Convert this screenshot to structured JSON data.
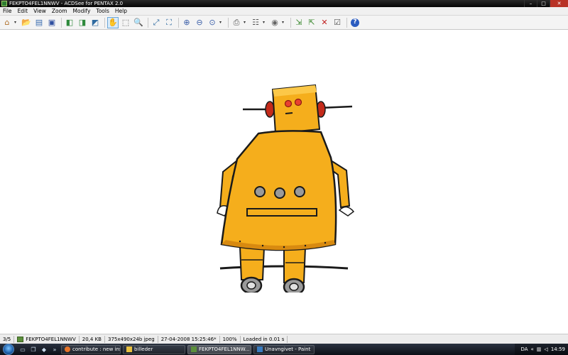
{
  "window": {
    "title": "FEKPTO4FEL1NNWV - ACDSee for PENTAX 2.0",
    "controls": {
      "minimize": "–",
      "maximize": "□",
      "close": "✕"
    }
  },
  "menu": [
    "File",
    "Edit",
    "View",
    "Zoom",
    "Modify",
    "Tools",
    "Help"
  ],
  "toolbar": [
    {
      "name": "browse-icon",
      "glyph": "⌂",
      "color": "#b0702a",
      "dropdown": true
    },
    {
      "name": "open-folder-icon",
      "glyph": "📂",
      "color": "#d8a820"
    },
    {
      "name": "open-file-icon",
      "glyph": "▤",
      "color": "#3a6db0"
    },
    {
      "name": "save-icon",
      "glyph": "▣",
      "color": "#3050a0"
    },
    {
      "sep": true
    },
    {
      "name": "previous-image-icon",
      "glyph": "◧",
      "color": "#2f8a3c"
    },
    {
      "name": "next-image-icon",
      "glyph": "◨",
      "color": "#2f8a3c"
    },
    {
      "name": "auto-advance-icon",
      "glyph": "◩",
      "color": "#2f6aa0"
    },
    {
      "sep": true
    },
    {
      "name": "hand-tool-icon",
      "glyph": "✋",
      "color": "#555",
      "active": true
    },
    {
      "name": "select-tool-icon",
      "glyph": "⬚",
      "color": "#555"
    },
    {
      "name": "zoom-tool-icon",
      "glyph": "🔍",
      "color": "#444"
    },
    {
      "sep": true
    },
    {
      "name": "fit-image-icon",
      "glyph": "⤢",
      "color": "#2f6aa0"
    },
    {
      "name": "full-screen-icon",
      "glyph": "⛶",
      "color": "#2f6aa0"
    },
    {
      "sep": true
    },
    {
      "name": "zoom-in-icon",
      "glyph": "⊕",
      "color": "#3a5ea8"
    },
    {
      "name": "zoom-out-icon",
      "glyph": "⊖",
      "color": "#3a5ea8"
    },
    {
      "name": "zoom-level-icon",
      "glyph": "⊙",
      "color": "#3a5ea8",
      "dropdown": true
    },
    {
      "sep": true
    },
    {
      "name": "print-icon",
      "glyph": "⎙",
      "color": "#555",
      "dropdown": true
    },
    {
      "name": "scanner-icon",
      "glyph": "☷",
      "color": "#555",
      "dropdown": true
    },
    {
      "name": "disc-icon",
      "glyph": "◉",
      "color": "#666",
      "dropdown": true
    },
    {
      "sep": true
    },
    {
      "name": "copy-to-folder-icon",
      "glyph": "⇲",
      "color": "#3c8a30"
    },
    {
      "name": "move-to-folder-icon",
      "glyph": "⇱",
      "color": "#3c8a30"
    },
    {
      "name": "delete-icon",
      "glyph": "✕",
      "color": "#c02020"
    },
    {
      "name": "properties-icon",
      "glyph": "☑",
      "color": "#555"
    },
    {
      "sep": true
    },
    {
      "name": "help-icon",
      "glyph": "?",
      "color": "#ffffff",
      "bg": "#2a5cc0"
    }
  ],
  "status": {
    "position": "3/5",
    "filename": "FEKPTO4FEL1NNWV",
    "size": "20,4 KB",
    "dimensions": "375x490x24b jpeg",
    "date": "27-04-2008 15:25:46*",
    "zoom": "100%",
    "load_time": "Loaded in 0.01 s"
  },
  "taskbar": {
    "tasks": [
      {
        "label": "contribute : new ins...",
        "color": "#e8752a"
      },
      {
        "label": "billeder",
        "color": "#e8c040"
      },
      {
        "label": "FEKPTO4FEL1NNW...",
        "color": "#5c8f3c",
        "active": true
      },
      {
        "label": "Unavngivet - Paint",
        "color": "#3a7cc0"
      }
    ],
    "language": "DA",
    "clock": "14:59"
  },
  "colors": {
    "robot_body": "#f5ae1c",
    "robot_shadow": "#d88a10",
    "robot_ear": "#c42a1a",
    "wheel": "#9a9a9a",
    "outline": "#1a1a1a"
  }
}
